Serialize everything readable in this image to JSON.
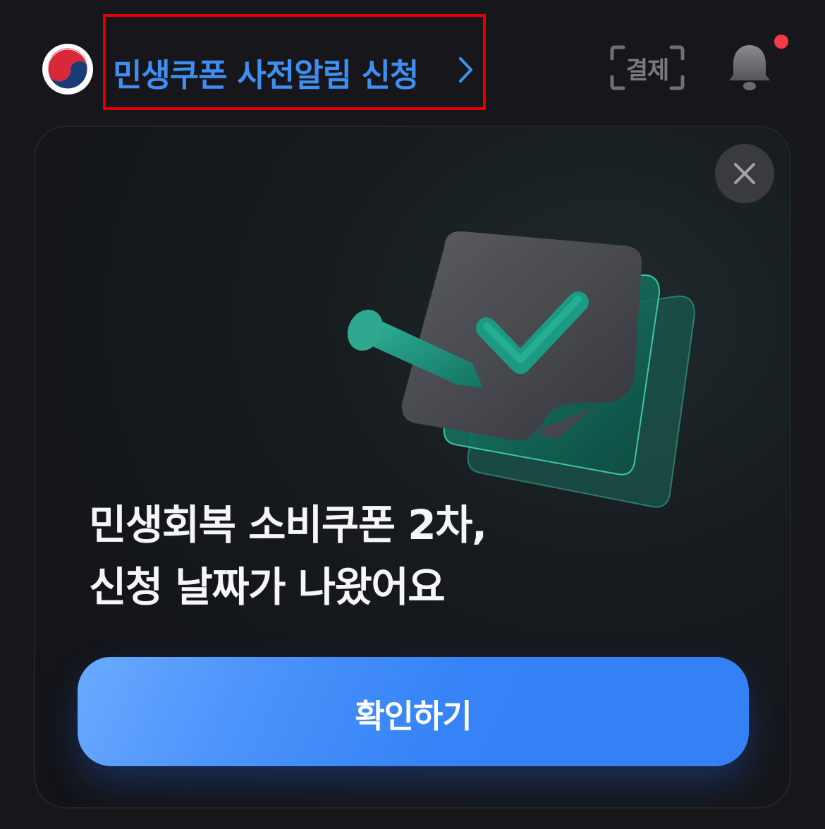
{
  "header": {
    "headline_link": "민생쿠폰 사전알림 신청",
    "pay_label": "결제",
    "notification_unread": true
  },
  "modal": {
    "title_line1": "민생회복 소비쿠폰 2차,",
    "title_line2": "신청 날짜가 나왔어요",
    "confirm_label": "확인하기"
  },
  "colors": {
    "headline": "#3f8ef2",
    "confirm_button": "#3583f6",
    "notification_dot": "#f43a4a",
    "background": "#17171b"
  },
  "icons": [
    "korea-government-logo-icon",
    "chevron-right-icon",
    "pay-scan-icon",
    "bell-icon",
    "close-icon",
    "checklist-illustration"
  ]
}
